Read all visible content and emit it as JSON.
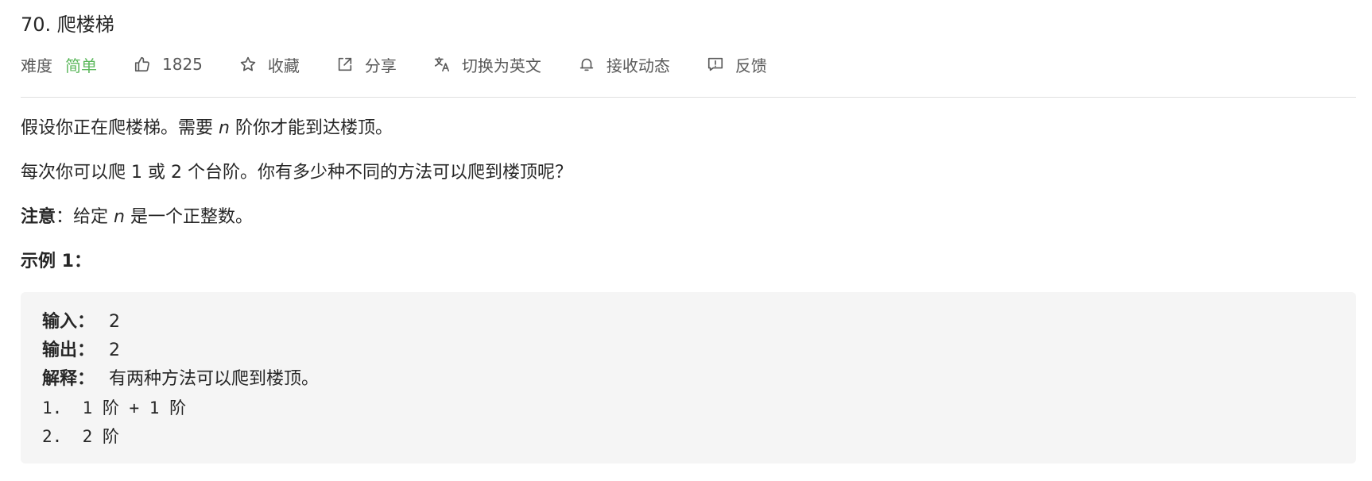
{
  "problem": {
    "title": "70. 爬楼梯"
  },
  "meta": {
    "difficulty_label": "难度",
    "difficulty_value": "简单",
    "difficulty_color": "#5cb85c",
    "likes": "1825",
    "favorite_label": "收藏",
    "share_label": "分享",
    "translate_label": "切换为英文",
    "subscribe_label": "接收动态",
    "feedback_label": "反馈",
    "icons": [
      "thumbs-up-icon",
      "star-icon",
      "share-icon",
      "translate-icon",
      "bell-icon",
      "feedback-icon"
    ]
  },
  "description": {
    "p1_pre": "假设你正在爬楼梯。需要 ",
    "p1_var": "n",
    "p1_post": " 阶你才能到达楼顶。",
    "p2": "每次你可以爬 1 或 2 个台阶。你有多少种不同的方法可以爬到楼顶呢？",
    "note_label": "注意",
    "note_pre": "：给定 ",
    "note_var": "n",
    "note_post": " 是一个正整数。",
    "example_heading": "示例 1："
  },
  "example": {
    "input_label": "输入：",
    "input_value": "2",
    "output_label": "输出：",
    "output_value": "2",
    "explain_label": "解释：",
    "explain_value": "有两种方法可以爬到楼顶。",
    "step1": "1.  1 阶 + 1 阶",
    "step2": "2.  2 阶"
  }
}
